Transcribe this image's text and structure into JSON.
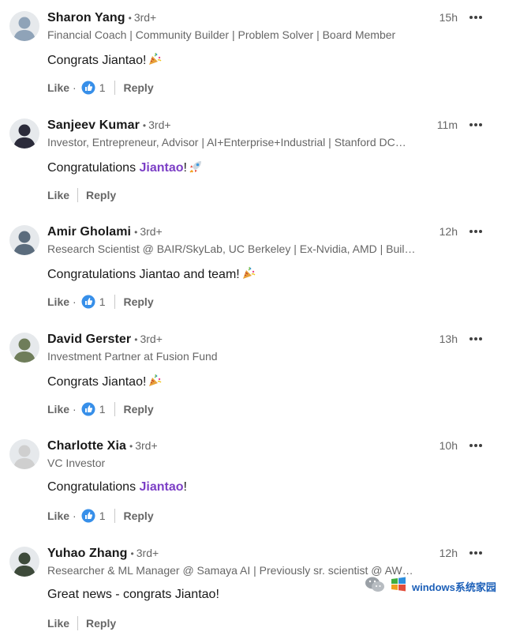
{
  "comments": [
    {
      "name": "Sharon Yang",
      "degree": "3rd+",
      "time": "15h",
      "headline": "Financial Coach | Community Builder | Problem Solver | Board Member",
      "text_before": "Congrats Jiantao!",
      "mention": "",
      "text_after": "",
      "emoji": "party-popper",
      "like_label": "Like",
      "reaction_count": "1",
      "reply_label": "Reply",
      "avatar_color": "#8fa3b8"
    },
    {
      "name": "Sanjeev Kumar",
      "degree": "3rd+",
      "time": "11m",
      "headline": "Investor, Entrepreneur, Advisor | AI+Enterprise+Industrial | Stanford DC…",
      "text_before": "Congratulations ",
      "mention": "Jiantao",
      "text_after": "!",
      "emoji": "rocket",
      "like_label": "Like",
      "reaction_count": "",
      "reply_label": "Reply",
      "avatar_color": "#2b2b3a"
    },
    {
      "name": "Amir Gholami",
      "degree": "3rd+",
      "time": "12h",
      "headline": "Research Scientist @ BAIR/SkyLab, UC Berkeley | Ex-Nvidia, AMD | Buil…",
      "text_before": "Congratulations Jiantao and team!",
      "mention": "",
      "text_after": "",
      "emoji": "party-popper",
      "like_label": "Like",
      "reaction_count": "1",
      "reply_label": "Reply",
      "avatar_color": "#5b6c7d"
    },
    {
      "name": "David Gerster",
      "degree": "3rd+",
      "time": "13h",
      "headline": "Investment Partner at Fusion Fund",
      "text_before": "Congrats Jiantao!",
      "mention": "",
      "text_after": "",
      "emoji": "party-popper",
      "like_label": "Like",
      "reaction_count": "1",
      "reply_label": "Reply",
      "avatar_color": "#6f7d5a"
    },
    {
      "name": "Charlotte Xia",
      "degree": "3rd+",
      "time": "10h",
      "headline": "VC Investor",
      "text_before": "Congratulations ",
      "mention": "Jiantao",
      "text_after": "!",
      "emoji": "",
      "like_label": "Like",
      "reaction_count": "1",
      "reply_label": "Reply",
      "avatar_color": "#cfcfcf"
    },
    {
      "name": "Yuhao Zhang",
      "degree": "3rd+",
      "time": "12h",
      "headline": "Researcher & ML Manager @ Samaya AI | Previously sr. scientist @ AW…",
      "text_before": "Great news - congrats Jiantao!",
      "mention": "",
      "text_after": "",
      "emoji": "",
      "like_label": "Like",
      "reaction_count": "",
      "reply_label": "Reply",
      "avatar_color": "#3d4a3a"
    }
  ],
  "watermark": {
    "text": "windows系统家园",
    "icon": "wechat-icon"
  },
  "colors": {
    "mention": "#7c3fc6",
    "like_blue": "#378fe9",
    "muted": "#666666"
  }
}
